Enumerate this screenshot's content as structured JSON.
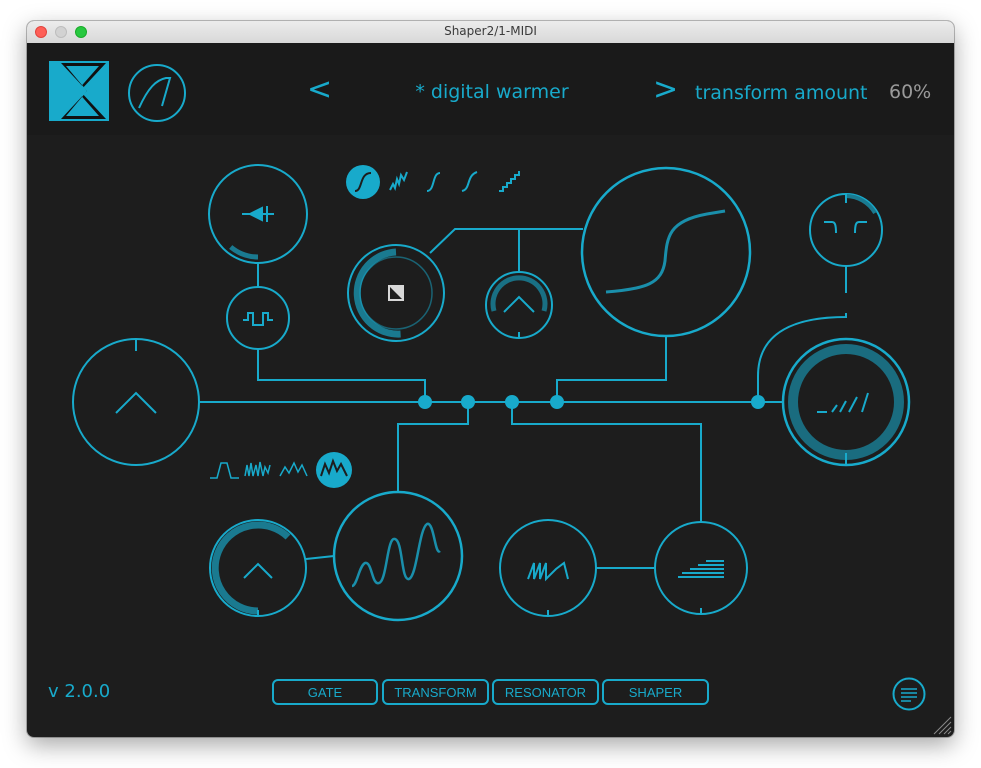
{
  "window": {
    "title": "Shaper2/1-MIDI"
  },
  "header": {
    "prev_label": "<",
    "next_label": ">",
    "preset_name": "* digital warmer",
    "param_label": "transform amount",
    "param_value": "60%"
  },
  "shape_selector": {
    "options": [
      "s-curve",
      "noise",
      "soft",
      "asym",
      "stairs"
    ],
    "selected": "s-curve"
  },
  "waveform_selector": {
    "options": [
      "square",
      "noise",
      "triangle",
      "random"
    ],
    "selected": "random"
  },
  "footer": {
    "version": "v 2.0.0",
    "tabs": [
      "GATE",
      "TRANSFORM",
      "RESONATOR",
      "SHAPER"
    ]
  },
  "colors": {
    "accent": "#18aacb",
    "background": "#1d1d1d",
    "ring": "#1a7a90"
  }
}
